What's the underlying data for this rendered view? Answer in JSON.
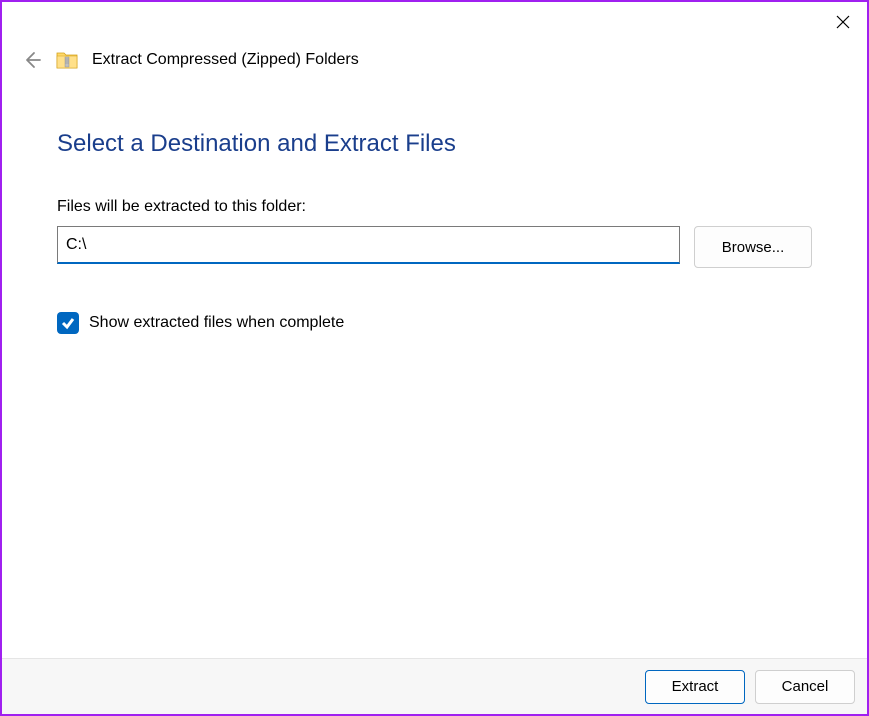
{
  "window": {
    "title": "Extract Compressed (Zipped) Folders"
  },
  "content": {
    "heading": "Select a Destination and Extract Files",
    "path_label": "Files will be extracted to this folder:",
    "path_value": "C:\\",
    "browse_label": "Browse...",
    "checkbox_label": "Show extracted files when complete",
    "checkbox_checked": true
  },
  "footer": {
    "extract_label": "Extract",
    "cancel_label": "Cancel"
  }
}
